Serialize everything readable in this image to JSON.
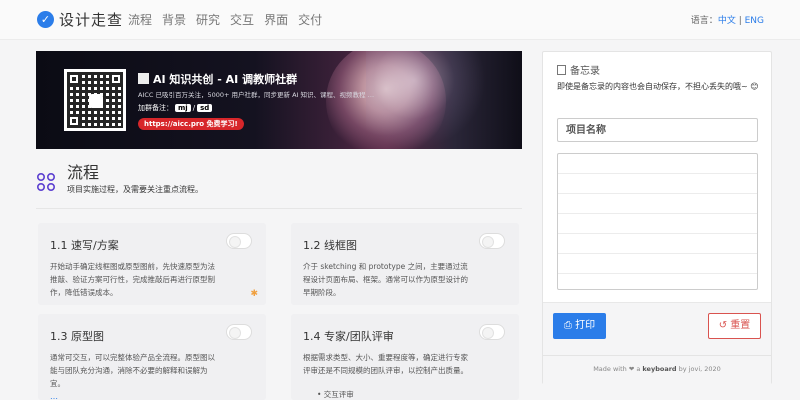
{
  "nav": {
    "brand": "设计走查",
    "items": [
      "流程",
      "背景",
      "研究",
      "交互",
      "界面",
      "交付"
    ],
    "lang_label": "语言：",
    "lang_zh": "中文",
    "lang_sep": " | ",
    "lang_en": "ENG"
  },
  "banner": {
    "title": "AI 知识共创 - AI 调教师社群",
    "subtitle": "AICC 已吸引百万关注，5000+ 用户社群，同步更新 AI 知识、课程、视频教程 …",
    "note_label": "加群备注：",
    "chip1": "mj",
    "chip_sep": "/",
    "chip2": "sd",
    "link": "https://aicc.pro 免费学习!"
  },
  "section": {
    "title": "流程",
    "desc": "项目实施过程，及需要关注重点流程。"
  },
  "cards": [
    {
      "title": "1.1 速写/方案",
      "text": "开始动手确定线框图或原型图前，先快速原型为法推敲、验证方案可行性，完成推敲后再进行原型制作，降低错误成本。"
    },
    {
      "title": "1.2 线框图",
      "text": "介于 sketching 和 prototype 之间，主要通过流程设计页面布局、框架。通常可以作为原型设计的早期阶段。"
    },
    {
      "title": "1.3 原型图",
      "text": "通常可交互，可以完整体验产品全流程。原型图以能与团队充分沟通，消除不必要的解释和误解为宜。"
    },
    {
      "title": "1.4 专家/团队评审",
      "text": "根据需求类型、大小、重要程度等，确定进行专家评审还是不同规模的团队评审，以控制产出质量。"
    }
  ],
  "card4_bullet": "•  交互评审",
  "card3_more": "…",
  "memo": {
    "title": "备忘录",
    "desc": "即使是备忘录的内容也会自动保存，不担心丢失的哦~ 😊",
    "name_placeholder": "项目名称",
    "print_label": "打印",
    "reset_label": "重置",
    "credit_prefix": "Made with ❤ a ",
    "credit_bold": "keyboard",
    "credit_suffix": " by jovi, 2020"
  },
  "colors": {
    "accent": "#2b7de9",
    "danger": "#d9534f",
    "banner_link": "#d7262a"
  }
}
